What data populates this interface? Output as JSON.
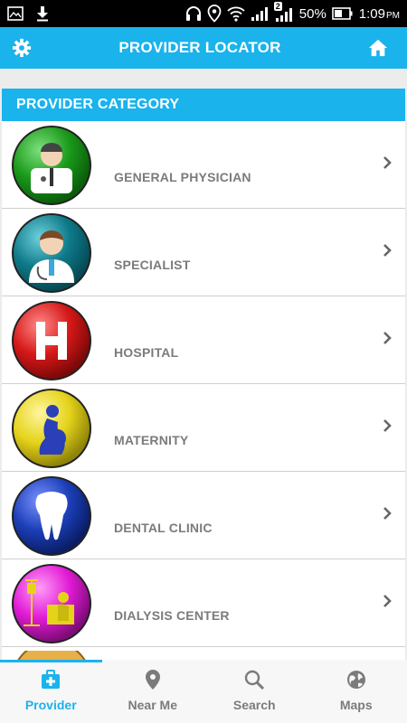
{
  "status_bar": {
    "battery": "50%",
    "time": "1:09",
    "ampm": "PM",
    "sim_badge": "2",
    "icons": [
      "image-icon",
      "download-icon",
      "headphones-icon",
      "location-icon",
      "wifi-icon",
      "signal-icon",
      "battery-icon"
    ]
  },
  "app_bar": {
    "title": "PROVIDER LOCATOR",
    "left_icon": "gear-icon",
    "right_icon": "home-icon"
  },
  "category": {
    "header": "PROVIDER CATEGORY",
    "items": [
      {
        "label": "GENERAL PHYSICIAN",
        "icon": "doctor-icon",
        "color": "#1a9a1a"
      },
      {
        "label": "SPECIALIST",
        "icon": "specialist-icon",
        "color": "#0e7a8a"
      },
      {
        "label": "HOSPITAL",
        "icon": "hospital-icon",
        "color": "#d61818"
      },
      {
        "label": "MATERNITY",
        "icon": "maternity-icon",
        "color": "#e5d31a"
      },
      {
        "label": "DENTAL CLINIC",
        "icon": "tooth-icon",
        "color": "#1b3fb8"
      },
      {
        "label": "DIALYSIS CENTER",
        "icon": "dialysis-icon",
        "color": "#e21bd6"
      }
    ]
  },
  "bottom_nav": {
    "items": [
      {
        "label": "Provider",
        "icon": "medical-case-icon",
        "active": true
      },
      {
        "label": "Near Me",
        "icon": "pin-icon",
        "active": false
      },
      {
        "label": "Search",
        "icon": "search-icon",
        "active": false
      },
      {
        "label": "Maps",
        "icon": "globe-icon",
        "active": false
      }
    ]
  },
  "colors": {
    "accent": "#1ab3ec",
    "label": "#7b7b7b"
  }
}
